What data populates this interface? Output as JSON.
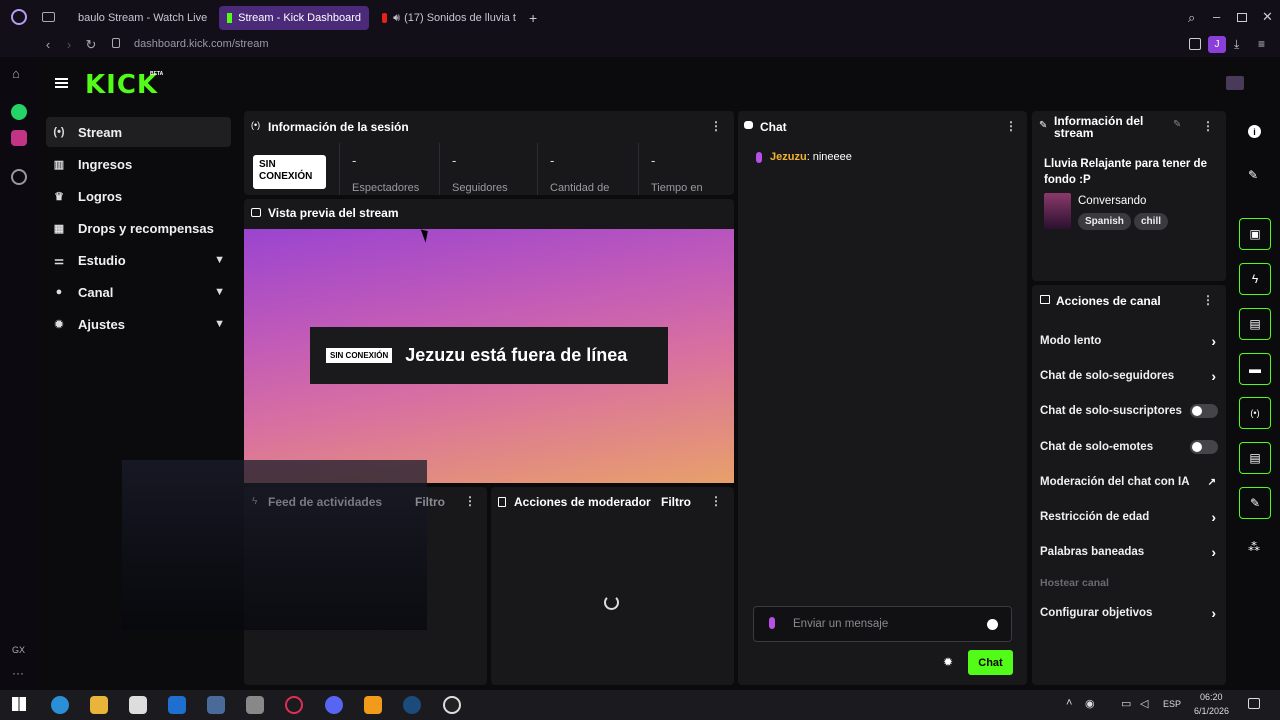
{
  "browser": {
    "tabs": [
      {
        "label": "baulo Stream - Watch Live"
      },
      {
        "label": "Stream - Kick Dashboard"
      },
      {
        "label": "(17) Sonidos de lluvia t"
      }
    ],
    "url": "dashboard.kick.com/stream",
    "profile_initial": "J"
  },
  "sidebar": {
    "logo": "KICK",
    "beta": "BETA",
    "items": [
      {
        "label": "Stream",
        "icon": "broadcast-icon"
      },
      {
        "label": "Ingresos",
        "icon": "chart-icon"
      },
      {
        "label": "Logros",
        "icon": "trophy-icon"
      },
      {
        "label": "Drops y recompensas",
        "icon": "grid-icon"
      },
      {
        "label": "Estudio",
        "icon": "sliders-icon"
      },
      {
        "label": "Canal",
        "icon": "user-icon"
      },
      {
        "label": "Ajustes",
        "icon": "gear-icon"
      }
    ],
    "gx_label": "GX"
  },
  "session": {
    "title": "Información de la sesión",
    "status": "SIN CONEXIÓN",
    "stats": [
      {
        "value": "-",
        "label": "Espectadores"
      },
      {
        "value": "-",
        "label": "Seguidores"
      },
      {
        "value": "-",
        "label": "Cantidad de"
      },
      {
        "value": "-",
        "label": "Tiempo en"
      }
    ]
  },
  "preview": {
    "title": "Vista previa del stream",
    "badge": "SIN CONEXIÓN",
    "message": "Jezuzu está fuera de línea"
  },
  "activity": {
    "title": "Feed de actividades",
    "filter": "Filtro"
  },
  "mod_actions": {
    "title": "Acciones de moderador",
    "filter": "Filtro"
  },
  "chat": {
    "title": "Chat",
    "messages": [
      {
        "user": "Jezuzu",
        "text": "nineeee"
      }
    ],
    "placeholder": "Enviar un mensaje",
    "send_label": "Chat"
  },
  "stream_info": {
    "title": "Información del stream",
    "stream_title": "Lluvia Relajante para tener de fondo :P",
    "category": "Conversando",
    "tags": [
      "Spanish",
      "chill"
    ]
  },
  "channel_actions": {
    "title": "Acciones de canal",
    "items": [
      {
        "label": "Modo lento",
        "control": "chevron"
      },
      {
        "label": "Chat de solo-seguidores",
        "control": "chevron"
      },
      {
        "label": "Chat de solo-suscriptores",
        "control": "toggle"
      },
      {
        "label": "Chat de solo-emotes",
        "control": "toggle"
      },
      {
        "label": "Moderación del chat con IA",
        "control": "external"
      },
      {
        "label": "Restricción de edad",
        "control": "chevron"
      },
      {
        "label": "Palabras baneadas",
        "control": "chevron"
      },
      {
        "label": "Hostear canal",
        "control": "disabled"
      },
      {
        "label": "Configurar objetivos",
        "control": "chevron"
      }
    ]
  },
  "taskbar": {
    "lang": "ESP",
    "time": "06:20",
    "date": "6/1/2026"
  },
  "colors": {
    "accent": "#53fc18",
    "panel": "#18181b",
    "background": "#0b0b0d"
  }
}
